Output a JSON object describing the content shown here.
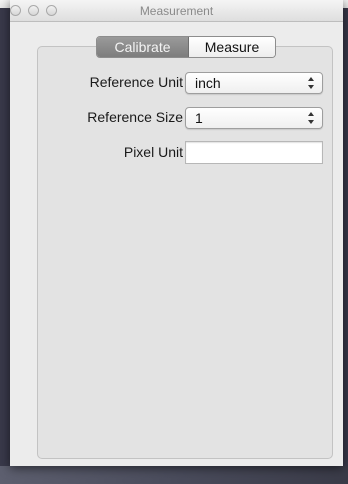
{
  "window": {
    "title": "Measurement"
  },
  "tabs": [
    {
      "label": "Calibrate",
      "selected": true
    },
    {
      "label": "Measure",
      "selected": false
    }
  ],
  "form": {
    "reference_unit": {
      "label": "Reference Unit",
      "value": "inch"
    },
    "reference_size": {
      "label": "Reference Size",
      "value": "1"
    },
    "pixel_unit": {
      "label": "Pixel Unit",
      "value": ""
    }
  },
  "icons": [
    "close-icon",
    "minimize-icon",
    "zoom-icon",
    "popup-arrows-icon"
  ]
}
